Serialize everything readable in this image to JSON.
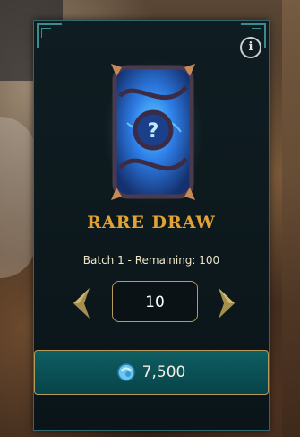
{
  "pack": {
    "title": "RARE DRAW",
    "batch_label": "Batch 1 - Remaining: 100",
    "quantity": "10",
    "price": "7,500"
  },
  "icons": {
    "info": "info-icon",
    "decrease": "chevron-left-icon",
    "increase": "chevron-right-icon",
    "currency": "gem-icon"
  },
  "colors": {
    "title": "#e2a236",
    "panel_border": "#2f6a6a",
    "button_bg": "#0a4f54",
    "button_border": "#b89a5a"
  }
}
